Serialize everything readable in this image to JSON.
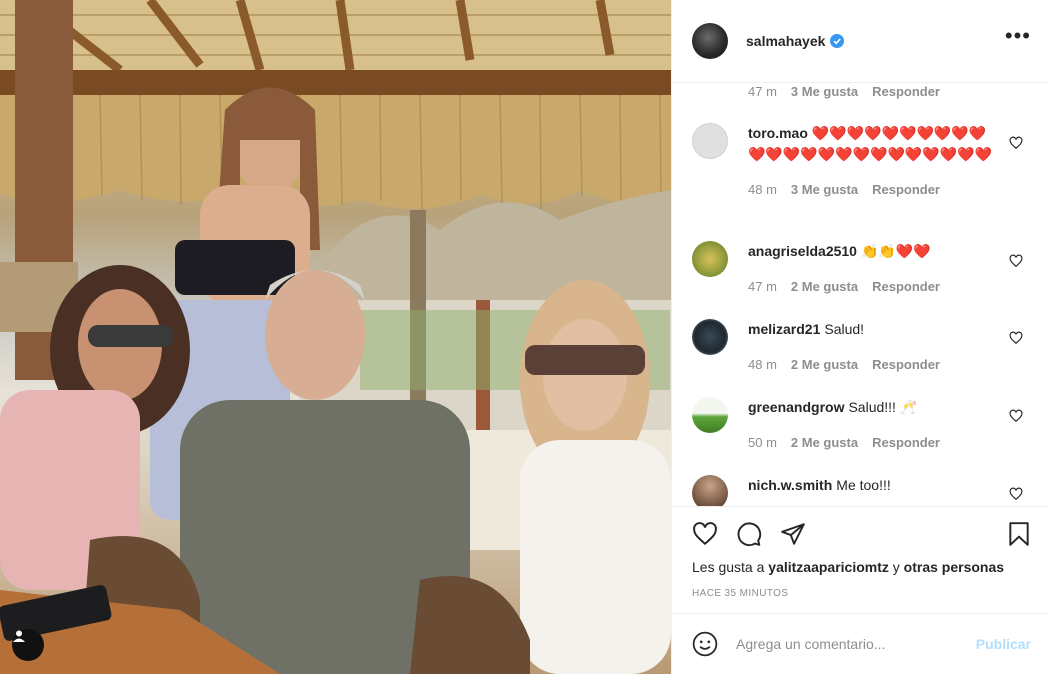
{
  "post": {
    "author": "salmahayek",
    "more_icon": "more-horizontal-icon",
    "verified_icon": "verified-badge-icon"
  },
  "first_meta": {
    "time": "47 m",
    "likes": "3 Me gusta",
    "reply": "Responder"
  },
  "comments": [
    {
      "user": "toro.mao",
      "text": "❤️❤️❤️❤️❤️❤️❤️❤️❤️❤️❤️❤️❤️❤️❤️❤️❤️❤️❤️❤️❤️❤️❤️❤️",
      "time": "48 m",
      "likes": "3 Me gusta",
      "reply": "Responder",
      "avatar_color": "#dbdbdb"
    },
    {
      "user": "anagriselda2510",
      "text": "👏👏❤️❤️",
      "time": "47 m",
      "likes": "2 Me gusta",
      "reply": "Responder",
      "avatar_color": "#b8a34a"
    },
    {
      "user": "melizard21",
      "text": "Salud!",
      "time": "48 m",
      "likes": "2 Me gusta",
      "reply": "Responder",
      "avatar_color": "#2f3a40"
    },
    {
      "user": "greenandgrow",
      "text": "Salud!!! 🥂",
      "time": "50 m",
      "likes": "2 Me gusta",
      "reply": "Responder",
      "avatar_color": "#6fa84a"
    },
    {
      "user": "nich.w.smith",
      "text": "Me too!!!",
      "time": "",
      "likes": "",
      "reply": "",
      "avatar_color": "#7a5a45"
    }
  ],
  "actions": {
    "like_icon": "heart-icon",
    "comment_icon": "comment-icon",
    "share_icon": "paper-plane-icon",
    "save_icon": "bookmark-icon"
  },
  "likes": {
    "prefix": "Les gusta a",
    "user": "yalitzaapariciomtz",
    "joiner": "y",
    "others": "otras personas"
  },
  "time_ago": "HACE 35 MINUTOS",
  "add_comment": {
    "placeholder": "Agrega un comentario...",
    "post_label": "Publicar",
    "emoji_icon": "smiley-icon"
  },
  "photo": {
    "user_tag_icon": "user-tag-icon",
    "description_icon": "photo"
  }
}
